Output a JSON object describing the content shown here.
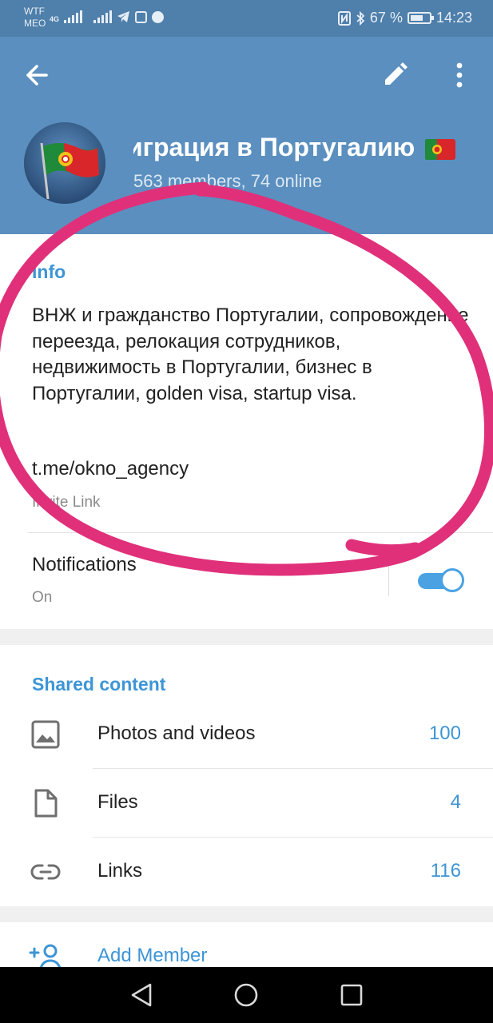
{
  "status_bar": {
    "carrier_line1": "WTF",
    "carrier_line2": "MEO",
    "network_type": "4G",
    "battery_percent": "67 %",
    "battery_level": 0.67,
    "time": "14:23",
    "left_icons": [
      "signal-icon",
      "signal-icon",
      "telegram-icon",
      "mail-icon",
      "facebook-icon"
    ],
    "right_icons": [
      "nfc-icon",
      "bluetooth-icon",
      "battery-icon"
    ]
  },
  "header": {
    "back_icon": "arrow-left-icon",
    "edit_icon": "pencil-icon",
    "more_icon": "more-vertical-icon",
    "group_title": "играция в Португалию",
    "group_title_emoji": "flag-portugal",
    "members_text": "563 members, 74 online"
  },
  "info": {
    "section_title": "Info",
    "description": "ВНЖ и гражданство Португалии, сопровождение переезда, релокация сотрудников, недвижимость в Португалии, бизнес в Португалии, golden visa, startup visa.",
    "link": "t.me/okno_agency",
    "link_caption": "Invite Link",
    "notifications_label": "Notifications",
    "notifications_state": "On",
    "notifications_enabled": true
  },
  "shared": {
    "section_title": "Shared content",
    "items": [
      {
        "label": "Photos and videos",
        "count": "100",
        "icon": "image-icon"
      },
      {
        "label": "Files",
        "count": "4",
        "icon": "file-icon"
      },
      {
        "label": "Links",
        "count": "116",
        "icon": "link-icon"
      }
    ]
  },
  "actions": {
    "add_member_label": "Add Member",
    "add_member_icon": "add-user-icon"
  },
  "nav": {
    "back": "triangle-back-icon",
    "home": "circle-home-icon",
    "recents": "square-recents-icon"
  },
  "colors": {
    "header": "#5b8fbf",
    "status_bar": "#4f7fab",
    "accent": "#3d95d6",
    "annotation": "#e0307a"
  }
}
